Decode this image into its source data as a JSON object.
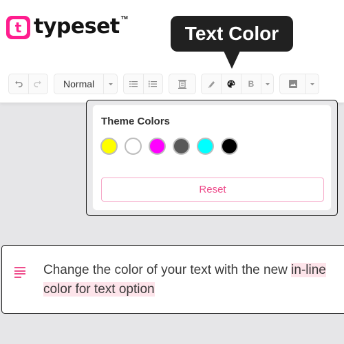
{
  "brand": {
    "logo_letter": "t",
    "name": "typeset",
    "trademark": "TM",
    "accent_color": "#ff1d8e"
  },
  "tooltip": {
    "text": "Text Color"
  },
  "toolbar": {
    "undo_icon": "undo-icon",
    "redo_icon": "redo-icon",
    "style_select_value": "Normal",
    "bullet_list_icon": "bullet-list-icon",
    "numbered_list_icon": "numbered-list-icon",
    "align_icon": "align-icon",
    "highlight_icon": "highlighter-icon",
    "text_color_icon": "palette-icon",
    "bold_label": "B",
    "image_icon": "image-icon"
  },
  "color_popup": {
    "title": "Theme Colors",
    "colors": [
      {
        "name": "yellow",
        "hex": "#ffff00"
      },
      {
        "name": "white",
        "hex": "#ffffff"
      },
      {
        "name": "magenta",
        "hex": "#ff00ff"
      },
      {
        "name": "dark-grey",
        "hex": "#595959"
      },
      {
        "name": "cyan",
        "hex": "#00ffff"
      },
      {
        "name": "black",
        "hex": "#000000"
      }
    ],
    "reset_label": "Reset"
  },
  "editor": {
    "text_plain": "Change the color of your text with the new ",
    "text_highlighted": "in-line color for text option"
  }
}
